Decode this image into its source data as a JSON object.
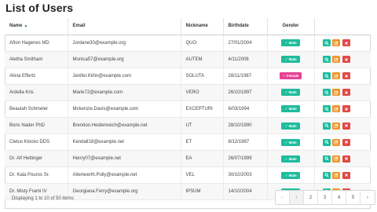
{
  "page": {
    "title": "List of Users"
  },
  "columns": {
    "name": "Name",
    "email": "Email",
    "nickname": "Nickname",
    "birthdate": "Birthdate",
    "gender": "Gender",
    "actions": ""
  },
  "rows": [
    {
      "name": "Afton Hagenes MD",
      "email": "Jordane30@example.org",
      "nickname": "QUO",
      "birthdate": "27/01/2004",
      "gender": "Male"
    },
    {
      "name": "Aletha Smitham",
      "email": "Monica57@example.org",
      "nickname": "AUTEM",
      "birthdate": "4/11/2006",
      "gender": "Male"
    },
    {
      "name": "Alivia Effertz",
      "email": "Jenifer.Kirlin@example.com",
      "nickname": "SOLUTA",
      "birthdate": "28/11/1987",
      "gender": "Female"
    },
    {
      "name": "Ardella Kris",
      "email": "Marie72@example.com",
      "nickname": "VERO",
      "birthdate": "26/10/1997",
      "gender": "Male"
    },
    {
      "name": "Beaulah Schmeler",
      "email": "Mckenzie.Davis@example.com",
      "nickname": "EXCEPTURI",
      "birthdate": "6/03/1994",
      "gender": "Male"
    },
    {
      "name": "Boris Nader PhD",
      "email": "Brendon.Heidenreich@example.net",
      "nickname": "UT",
      "birthdate": "28/10/1990",
      "gender": "Male"
    },
    {
      "name": "Cletus Klocko DDS",
      "email": "Kendall18@example.net",
      "nickname": "ET",
      "birthdate": "8/12/1987",
      "gender": "Male"
    },
    {
      "name": "Dr. Alf Hettinger",
      "email": "Henry07@example.net",
      "nickname": "EA",
      "birthdate": "26/07/1999",
      "gender": "Male"
    },
    {
      "name": "Dr. Kaia Pouros Sr.",
      "email": "Altenwerth.Polly@example.net",
      "nickname": "VEL",
      "birthdate": "30/10/2003",
      "gender": "Male"
    },
    {
      "name": "Dr. Misty Frami IV",
      "email": "Georgiana.Ferry@example.org",
      "nickname": "IPSUM",
      "birthdate": "14/10/2004",
      "gender": "Male"
    }
  ],
  "footer": {
    "status": "Displaying 1 to 10 of 50 items"
  },
  "pagination": {
    "prev": "‹",
    "pages": [
      "1",
      "2",
      "3",
      "4",
      "5"
    ],
    "next": "›"
  },
  "colors": {
    "male": "#1fbc9c",
    "female": "#e64395",
    "view": "#1abc9c",
    "edit": "#f0962b",
    "delete": "#e04848",
    "sort": "#2a7ab0"
  },
  "icons": {
    "sort": "sort-up-icon",
    "male": "mars-icon",
    "female": "venus-icon",
    "view": "search-icon",
    "edit": "edit-icon",
    "delete": "close-icon"
  }
}
